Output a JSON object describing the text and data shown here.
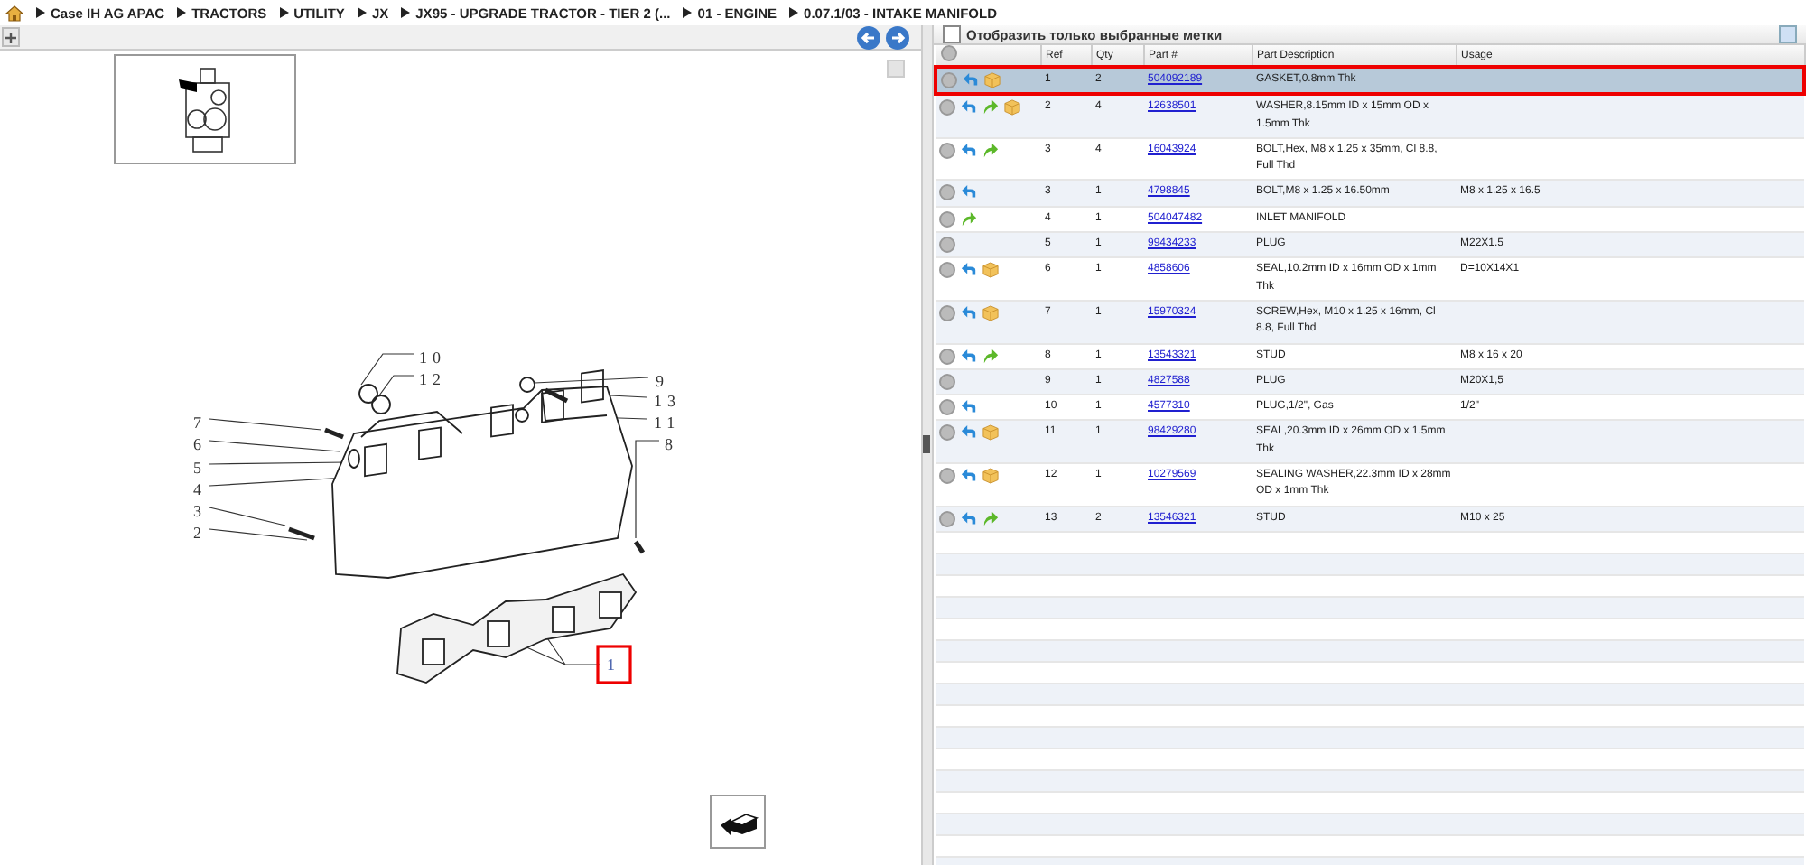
{
  "breadcrumb": [
    "Case IH AG APAC",
    "TRACTORS",
    "UTILITY",
    "JX",
    "JX95 - UPGRADE TRACTOR - TIER 2 (...",
    "01 - ENGINE",
    "0.07.1/03 - INTAKE MANIFOLD"
  ],
  "diagram": {
    "callouts": [
      {
        "label": "10",
        "selected": false
      },
      {
        "label": "12",
        "selected": false
      },
      {
        "label": "9",
        "selected": false
      },
      {
        "label": "13",
        "selected": false
      },
      {
        "label": "11",
        "selected": false
      },
      {
        "label": "8",
        "selected": false
      },
      {
        "label": "7",
        "selected": false
      },
      {
        "label": "6",
        "selected": false
      },
      {
        "label": "5",
        "selected": false
      },
      {
        "label": "4",
        "selected": false
      },
      {
        "label": "3",
        "selected": false
      },
      {
        "label": "2",
        "selected": false
      },
      {
        "label": "1",
        "selected": true
      }
    ]
  },
  "parts": {
    "filter": {
      "label": "Отобразить только выбранные метки",
      "checked": false
    },
    "columns": [
      "Ref",
      "Qty",
      "Part #",
      "Part Description",
      "Usage"
    ],
    "rows": [
      {
        "ref": "1",
        "qty": "2",
        "part": "504092189",
        "description": "GASKET,0.8mm Thk",
        "usage": "",
        "return_arrow": true,
        "forward_arrow": false,
        "package": true,
        "selected": true
      },
      {
        "ref": "2",
        "qty": "4",
        "part": "12638501",
        "description": "WASHER,8.15mm ID x 15mm OD x 1.5mm Thk",
        "usage": "",
        "return_arrow": true,
        "forward_arrow": true,
        "package": true,
        "selected": false
      },
      {
        "ref": "3",
        "qty": "4",
        "part": "16043924",
        "description": "BOLT,Hex, M8 x 1.25 x 35mm, Cl 8.8, Full Thd",
        "usage": "",
        "return_arrow": true,
        "forward_arrow": true,
        "package": false,
        "selected": false
      },
      {
        "ref": "3",
        "qty": "1",
        "part": "4798845",
        "description": "BOLT,M8 x 1.25 x 16.50mm",
        "usage": "M8 x 1.25 x 16.5",
        "return_arrow": true,
        "forward_arrow": false,
        "package": false,
        "selected": false
      },
      {
        "ref": "4",
        "qty": "1",
        "part": "504047482",
        "description": "INLET MANIFOLD",
        "usage": "",
        "return_arrow": false,
        "forward_arrow": true,
        "package": false,
        "selected": false
      },
      {
        "ref": "5",
        "qty": "1",
        "part": "99434233",
        "description": "PLUG",
        "usage": "M22X1.5",
        "return_arrow": false,
        "forward_arrow": false,
        "package": false,
        "selected": false
      },
      {
        "ref": "6",
        "qty": "1",
        "part": "4858606",
        "description": "SEAL,10.2mm ID x 16mm OD x 1mm Thk",
        "usage": "D=10X14X1",
        "return_arrow": true,
        "forward_arrow": false,
        "package": true,
        "selected": false
      },
      {
        "ref": "7",
        "qty": "1",
        "part": "15970324",
        "description": "SCREW,Hex, M10 x 1.25 x 16mm, Cl 8.8, Full Thd",
        "usage": "",
        "return_arrow": true,
        "forward_arrow": false,
        "package": true,
        "selected": false
      },
      {
        "ref": "8",
        "qty": "1",
        "part": "13543321",
        "description": "STUD",
        "usage": "M8 x 16 x 20",
        "return_arrow": true,
        "forward_arrow": true,
        "package": false,
        "selected": false
      },
      {
        "ref": "9",
        "qty": "1",
        "part": "4827588",
        "description": "PLUG",
        "usage": "M20X1,5",
        "return_arrow": false,
        "forward_arrow": false,
        "package": false,
        "selected": false
      },
      {
        "ref": "10",
        "qty": "1",
        "part": "4577310",
        "description": "PLUG,1/2\", Gas",
        "usage": "1/2\"",
        "return_arrow": true,
        "forward_arrow": false,
        "package": false,
        "selected": false
      },
      {
        "ref": "11",
        "qty": "1",
        "part": "98429280",
        "description": "SEAL,20.3mm ID x 26mm OD x 1.5mm Thk",
        "usage": "",
        "return_arrow": true,
        "forward_arrow": false,
        "package": true,
        "selected": false
      },
      {
        "ref": "12",
        "qty": "1",
        "part": "10279569",
        "description": "SEALING WASHER,22.3mm ID x 28mm OD x 1mm Thk",
        "usage": "",
        "return_arrow": true,
        "forward_arrow": false,
        "package": true,
        "selected": false
      },
      {
        "ref": "13",
        "qty": "2",
        "part": "13546321",
        "description": "STUD",
        "usage": "M10 x 25",
        "return_arrow": true,
        "forward_arrow": true,
        "package": false,
        "selected": false
      }
    ]
  }
}
